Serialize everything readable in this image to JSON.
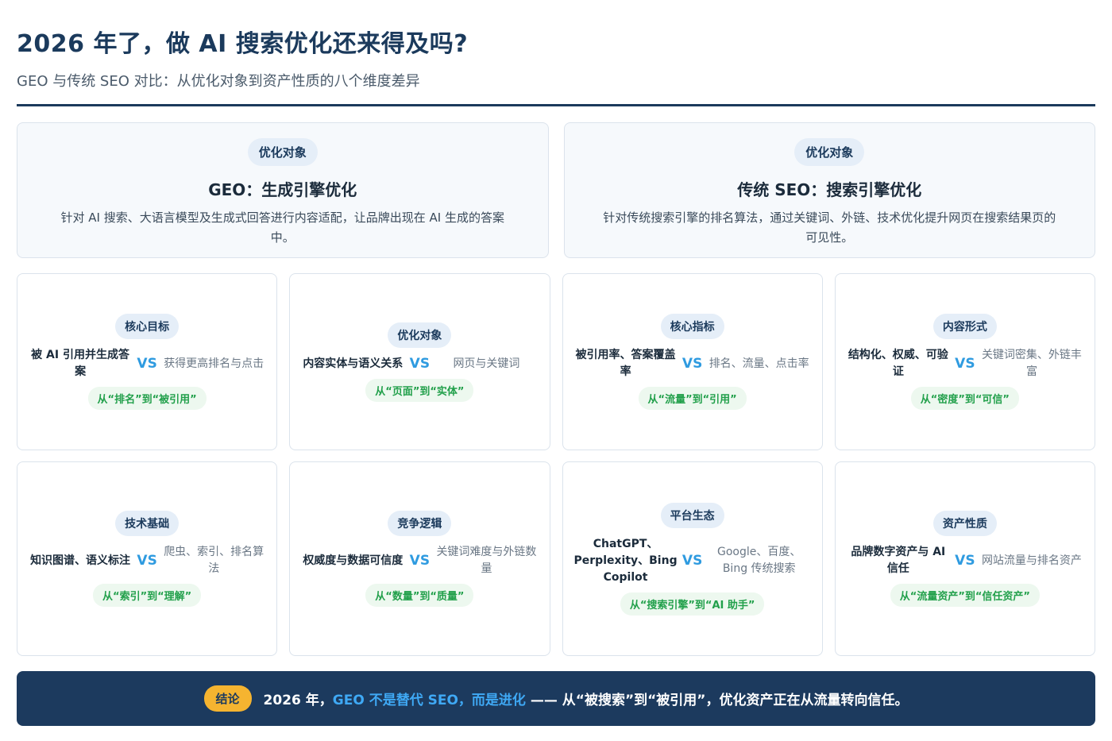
{
  "header": {
    "title": "2026 年了，做 AI 搜索优化还来得及吗?",
    "subtitle": "GEO 与传统 SEO 对比：从优化对象到资产性质的八个维度差异"
  },
  "top_cards": [
    {
      "pill": "优化对象",
      "title": "GEO：生成引擎优化",
      "desc": "针对 AI 搜索、大语言模型及生成式回答进行内容适配，让品牌出现在 AI 生成的答案中。"
    },
    {
      "pill": "优化对象",
      "title": "传统 SEO：搜索引擎优化",
      "desc": "针对传统搜索引擎的排名算法，通过关键词、外链、技术优化提升网页在搜索结果页的可见性。"
    }
  ],
  "vs_label": "VS",
  "cards": [
    {
      "pill": "核心目标",
      "left": "被 AI 引用并生成答案",
      "right": "获得更高排名与点击",
      "trend": "从“排名”到“被引用”"
    },
    {
      "pill": "优化对象",
      "left": "内容实体与语义关系",
      "right": "网页与关键词",
      "trend": "从“页面”到“实体”"
    },
    {
      "pill": "核心指标",
      "left": "被引用率、答案覆盖率",
      "right": "排名、流量、点击率",
      "trend": "从“流量”到“引用”"
    },
    {
      "pill": "内容形式",
      "left": "结构化、权威、可验证",
      "right": "关键词密集、外链丰富",
      "trend": "从“密度”到“可信”"
    },
    {
      "pill": "技术基础",
      "left": "知识图谱、语义标注",
      "right": "爬虫、索引、排名算法",
      "trend": "从“索引”到“理解”"
    },
    {
      "pill": "竞争逻辑",
      "left": "权威度与数据可信度",
      "right": "关键词难度与外链数量",
      "trend": "从“数量”到“质量”"
    },
    {
      "pill": "平台生态",
      "left": "ChatGPT、Perplexity、Bing Copilot",
      "right": "Google、百度、Bing 传统搜索",
      "trend": "从“搜索引擎”到“AI 助手”"
    },
    {
      "pill": "资产性质",
      "left": "品牌数字资产与 AI 信任",
      "right": "网站流量与排名资产",
      "trend": "从“流量资产”到“信任资产”"
    }
  ],
  "footer": {
    "badge": "结论",
    "text_pre": "2026 年，",
    "text_highlight": "GEO 不是替代 SEO，而是进化",
    "text_post": " —— 从“被搜索”到“被引用”，优化资产正在从流量转向信任。"
  },
  "colors": {
    "navy": "#1c3a5e",
    "vs_blue": "#2f9be0",
    "trend_green": "#22a04b",
    "badge_yellow": "#f5b430",
    "highlight_blue": "#3fa9f5"
  }
}
